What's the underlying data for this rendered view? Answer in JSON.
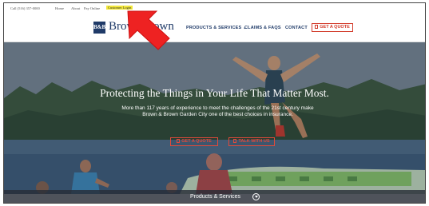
{
  "utility_bar": {
    "call": "Call (516) 357-0000",
    "home": "Home",
    "about": "About",
    "pay_online": "Pay Online",
    "customer_login": "Customer Login"
  },
  "header": {
    "logo_mark": "B&B",
    "logo_text_1": "Brow",
    "logo_text_2": "own",
    "nav": {
      "products": "PRODUCTS & SERVICES ⌄",
      "claims": "CLAIMS & FAQS",
      "contact": "CONTACT"
    },
    "quote_button": "GET A QUOTE"
  },
  "hero": {
    "headline": "Protecting the Things in Your Life That Matter Most.",
    "subline": "More than 117 years of experience to meet the challenges of the 21st century make Brown & Brown Garden City one of the best choices in insurance.",
    "cta_quote": "GET A QUOTE",
    "cta_talk": "TALK WITH US"
  },
  "bottom_strip": {
    "label": "Products & Services"
  },
  "icons": {
    "document": "document-icon",
    "chevron": "chevron-down-circle-icon",
    "annotation": "red-arrow-annotation"
  },
  "colors": {
    "brand_navy": "#1f3a68",
    "accent_red": "#d23a2a",
    "highlight_yellow": "#f3e83a"
  }
}
